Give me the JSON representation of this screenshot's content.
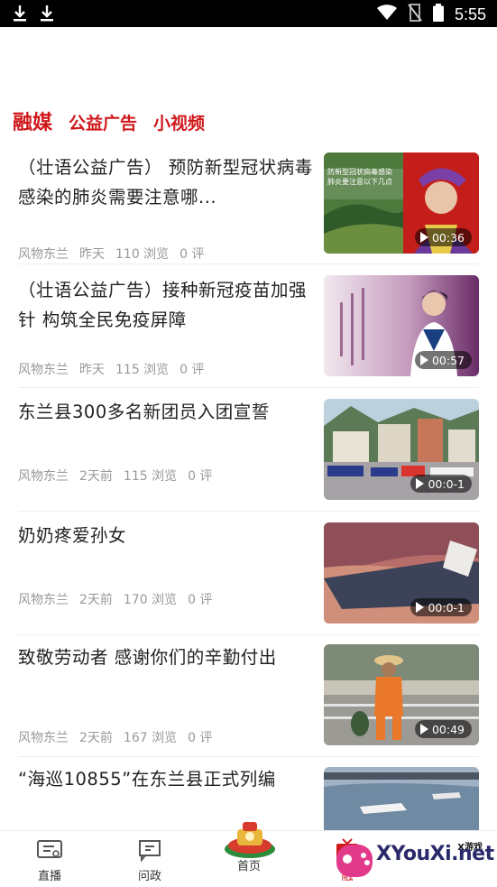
{
  "status_bar": {
    "time": "5:55",
    "icons": [
      "download-icon",
      "download-icon",
      "wifi-icon",
      "no-signal-icon",
      "battery-icon"
    ]
  },
  "tabs": [
    {
      "label": "融媒",
      "active": true
    },
    {
      "label": "公益广告",
      "active": false
    },
    {
      "label": "小视频",
      "active": false
    }
  ],
  "articles": [
    {
      "title": "（壮语公益广告） 预防新型冠状病毒感染的肺炎需要注意哪...",
      "source": "风物东兰",
      "time": "昨天",
      "views": "110 浏览",
      "comments": "0 评",
      "duration": "00:36"
    },
    {
      "title": "（壮语公益广告）接种新冠疫苗加强针 构筑全民免疫屏障",
      "source": "风物东兰",
      "time": "昨天",
      "views": "115 浏览",
      "comments": "0 评",
      "duration": "00:57"
    },
    {
      "title": "东兰县300多名新团员入团宣誓",
      "source": "风物东兰",
      "time": "2天前",
      "views": "115 浏览",
      "comments": "0 评",
      "duration": "00:0-1"
    },
    {
      "title": "奶奶疼爱孙女",
      "source": "风物东兰",
      "time": "2天前",
      "views": "170 浏览",
      "comments": "0 评",
      "duration": "00:0-1"
    },
    {
      "title": "致敬劳动者 感谢你们的辛勤付出",
      "source": "风物东兰",
      "time": "2天前",
      "views": "167 浏览",
      "comments": "0 评",
      "duration": "00:49"
    },
    {
      "title": "“海巡10855”在东兰县正式列编",
      "source": "",
      "time": "",
      "views": "",
      "comments": "",
      "duration": ""
    }
  ],
  "thumb_overlay_text": {
    "t1": "防新型冠状病毒感染",
    "t1b": "肺炎要注意以下几点"
  },
  "bottom_nav": [
    {
      "label": "直播",
      "icon": "live-tv-icon"
    },
    {
      "label": "问政",
      "icon": "chat-icon"
    },
    {
      "label": "首页",
      "icon": "home-logo-icon"
    },
    {
      "label": "融",
      "icon": "media-icon"
    }
  ],
  "watermark": {
    "text": "XYouXi.net",
    "small": "X游戏"
  },
  "colors": {
    "accent": "#d0181b",
    "meta": "#999999",
    "title": "#222222"
  }
}
